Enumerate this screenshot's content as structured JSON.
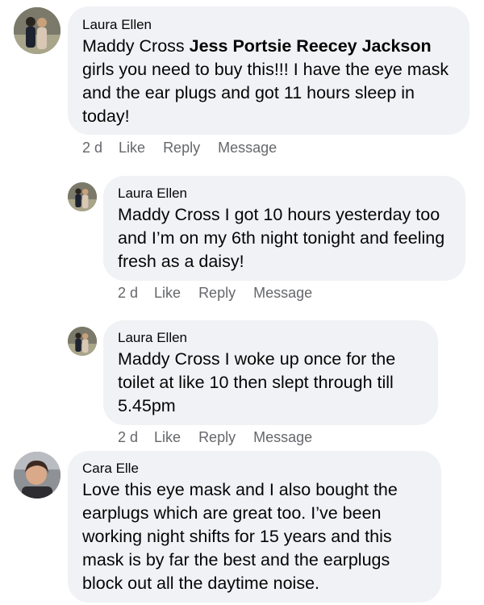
{
  "comments": [
    {
      "author": "Laura Ellen",
      "mentions": [
        "Maddy Cross",
        "Jess Portsie Reecey Jackson"
      ],
      "text": "girls you need to buy this!!! I have the eye mask and the ear plugs and got 11 hours sleep in today!",
      "time": "2 d",
      "like": "Like",
      "reply": "Reply",
      "message": "Message"
    },
    {
      "author": "Laura Ellen",
      "text": "Maddy Cross I got 10 hours yesterday too and I’m on my 6th night tonight and feeling fresh as a daisy!",
      "time": "2 d",
      "like": "Like",
      "reply": "Reply",
      "message": "Message"
    },
    {
      "author": "Laura Ellen",
      "text": "Maddy Cross I woke up once for the toilet at like 10 then slept through till 5.45pm",
      "time": "2 d",
      "like": "Like",
      "reply": "Reply",
      "message": "Message"
    },
    {
      "author": "Cara Elle",
      "text": "Love this eye mask and I also bought the earplugs which are great too. I’ve been working night shifts for 15 years and this mask is by far the best and the earplugs block out all the daytime noise."
    }
  ],
  "icons": {
    "avatar_laura": "profile-photo-couple",
    "avatar_cara": "profile-photo-woman"
  },
  "colors": {
    "bubble": "#f0f2f5",
    "text": "#050505",
    "meta": "#65676b"
  }
}
